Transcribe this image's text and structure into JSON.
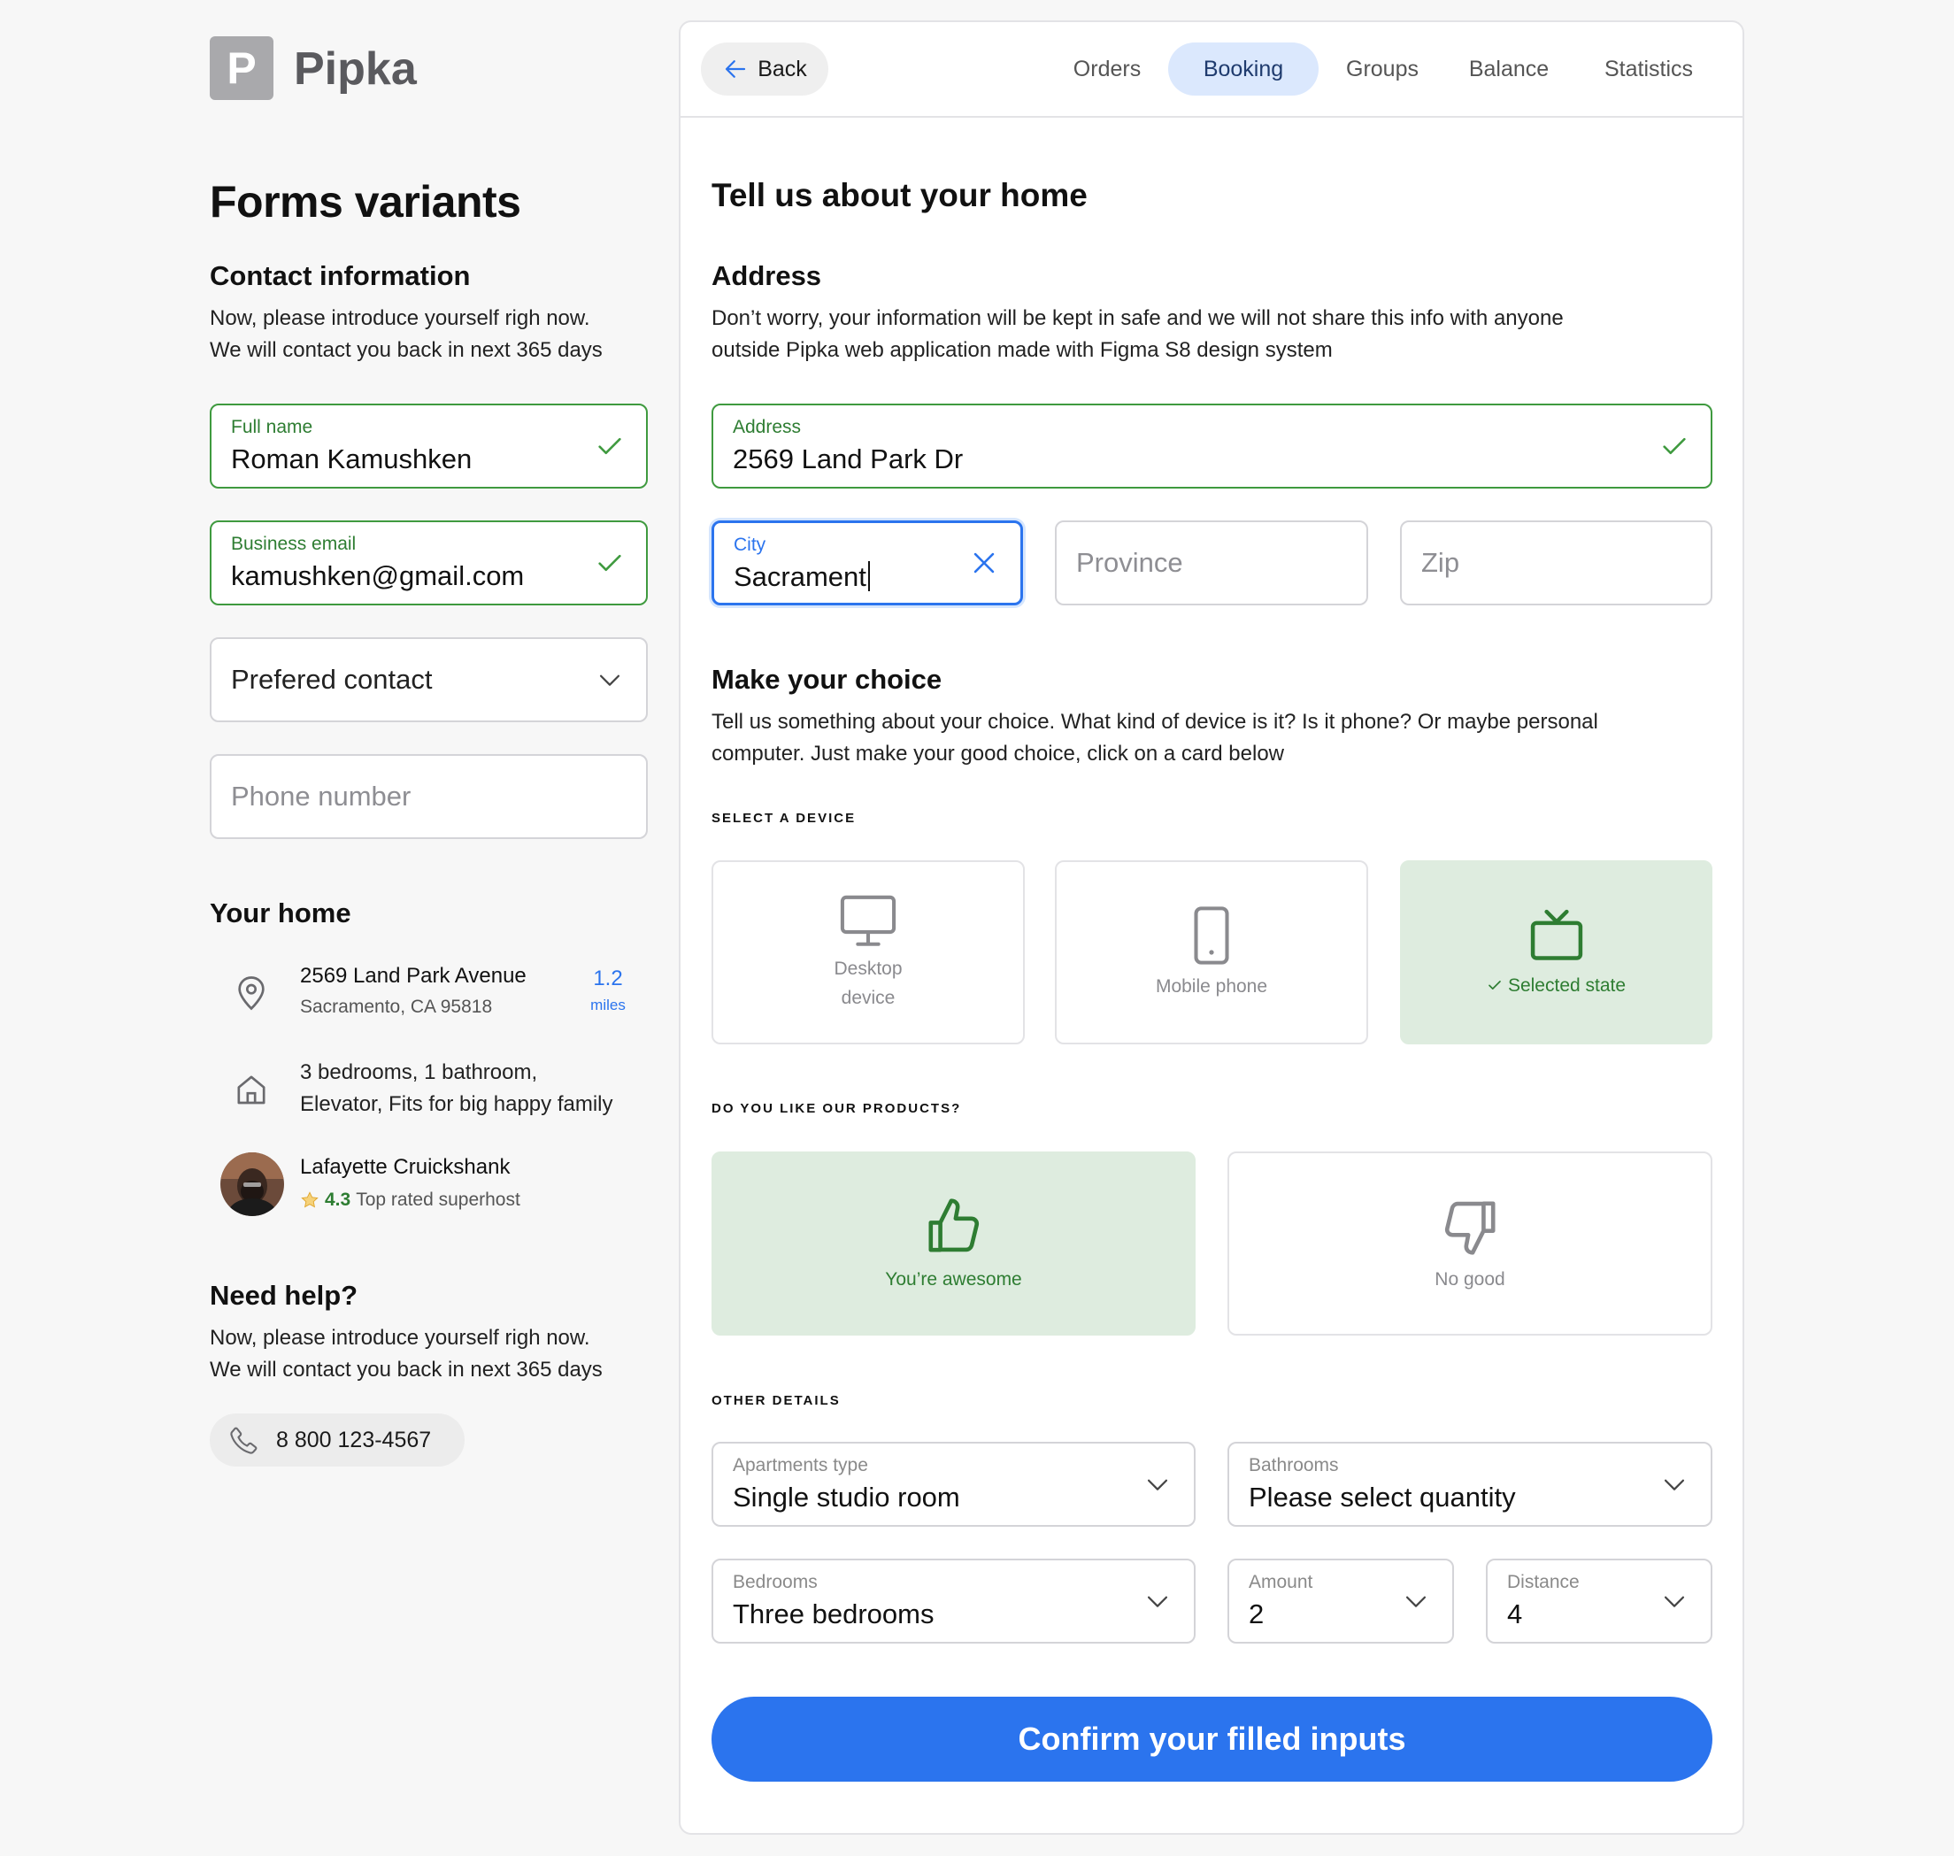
{
  "brand": {
    "logo_letter": "P",
    "name": "Pipka"
  },
  "left": {
    "page_title": "Forms variants",
    "contact": {
      "heading": "Contact information",
      "line1": "Now, please introduce yourself righ now.",
      "line2": "We will contact you back in next 365 days",
      "full_name": {
        "label": "Full name",
        "value": "Roman Kamushken"
      },
      "email": {
        "label": "Business email",
        "value": "kamushken@gmail.com"
      },
      "preferred_contact": {
        "placeholder": "Prefered contact"
      },
      "phone": {
        "placeholder": "Phone number"
      }
    },
    "home": {
      "heading": "Your home",
      "address_line1": "2569 Land Park Avenue",
      "address_line2": "Sacramento, CA 95818",
      "distance_value": "1.2",
      "distance_unit": "miles",
      "features_line1": "3 bedrooms, 1 bathroom,",
      "features_line2": "Elevator, Fits for big happy family",
      "host_name": "Lafayette Cruickshank",
      "host_rating": "4.3",
      "host_badge": "Top rated superhost"
    },
    "help": {
      "heading": "Need help?",
      "line1": "Now, please introduce yourself righ now.",
      "line2": "We will contact you back in next 365 days",
      "phone": "8 800 123-4567"
    }
  },
  "nav": {
    "back": "Back",
    "tabs": [
      "Orders",
      "Booking",
      "Groups",
      "Balance",
      "Statistics"
    ],
    "active_tab": "Booking"
  },
  "form": {
    "title": "Tell us about your home",
    "address": {
      "heading": "Address",
      "line1": "Don’t worry, your information will be kept in safe and we will not share this info with anyone",
      "line2": "outside Pipka web application made with Figma S8 design system",
      "address_field": {
        "label": "Address",
        "value": "2569 Land Park Dr"
      },
      "city_field": {
        "label": "City",
        "value": "Sacrament"
      },
      "province_placeholder": "Province",
      "zip_placeholder": "Zip"
    },
    "choice": {
      "heading": "Make your choice",
      "line1": "Tell us something about your choice. What kind of device is it? Is it phone? Or maybe personal",
      "line2": "computer. Just make your good choice, click on a card below",
      "device_label": "SELECT A DEVICE",
      "devices": [
        {
          "label_line1": "Desktop",
          "label_line2": "device",
          "icon": "desktop-icon",
          "selected": false
        },
        {
          "label": "Mobile phone",
          "icon": "mobile-phone-icon",
          "selected": false
        },
        {
          "label": "Selected state",
          "icon": "tv-icon",
          "selected": true
        }
      ],
      "like_label": "DO YOU LIKE OUR PRODUCTS?",
      "likes": [
        {
          "label": "You’re awesome",
          "icon": "thumbs-up-icon",
          "selected": true
        },
        {
          "label": "No good",
          "icon": "thumbs-down-icon",
          "selected": false
        }
      ]
    },
    "other": {
      "label": "OTHER DETAILS",
      "apartment_type": {
        "label": "Apartments type",
        "value": "Single studio room"
      },
      "bathrooms": {
        "label": "Bathrooms",
        "value": "Please select quantity"
      },
      "bedrooms": {
        "label": "Bedrooms",
        "value": "Three bedrooms"
      },
      "amount": {
        "label": "Amount",
        "value": "2"
      },
      "distance": {
        "label": "Distance",
        "value": "4"
      }
    },
    "confirm": "Confirm your filled inputs"
  },
  "colors": {
    "accent_blue": "#2b74ee",
    "success_green": "#3f9a3f",
    "selected_bg": "#deecdf",
    "active_tab_bg": "#dbe8fd"
  }
}
